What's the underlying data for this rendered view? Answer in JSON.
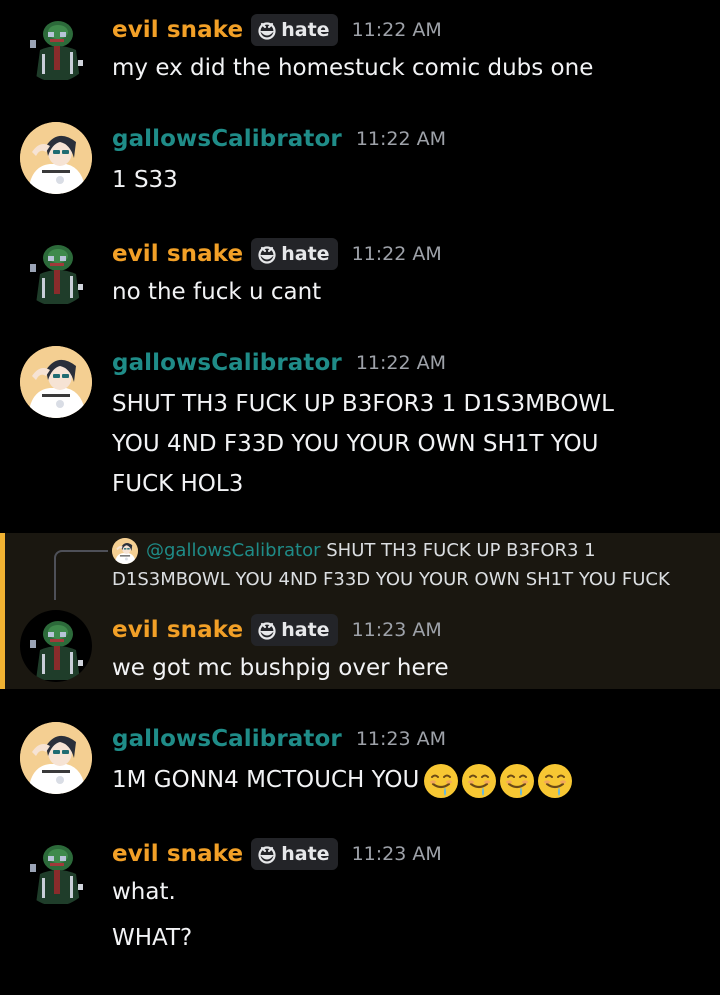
{
  "messages": [
    {
      "user": "evil snake",
      "tag": "hate",
      "time": "11:22 AM",
      "lines": [
        "my ex did the homestuck comic dubs one"
      ]
    },
    {
      "user": "gallowsCalibrator",
      "time": "11:22 AM",
      "lines": [
        "1 S33"
      ]
    },
    {
      "user": "evil snake",
      "tag": "hate",
      "time": "11:22 AM",
      "lines": [
        "no the fuck u cant"
      ]
    },
    {
      "user": "gallowsCalibrator",
      "time": "11:22 AM",
      "lines": [
        "SHUT TH3 FUCK UP B3FOR3 1 D1S3MBOWL",
        "YOU 4ND F33D YOU YOUR OWN SH1T YOU",
        "FUCK HOL3"
      ]
    },
    {
      "user": "evil snake",
      "tag": "hate",
      "time": "11:23 AM",
      "lines": [
        "we got mc bushpig over here"
      ],
      "reply": {
        "mention": "@gallowsCalibrator",
        "text_line1": "SHUT TH3 FUCK UP B3FOR3 1",
        "text_line2": "D1S3MBOWL YOU 4ND F33D YOU YOUR OWN SH1T YOU FUCK"
      }
    },
    {
      "user": "gallowsCalibrator",
      "time": "11:23 AM",
      "lines": [
        "1M GONN4 MCTOUCH YOU"
      ],
      "emoji_count": 4,
      "emoji_name": "drooling-face-emoji"
    },
    {
      "user": "evil snake",
      "tag": "hate",
      "time": "11:23 AM",
      "lines": [
        "what.",
        "WHAT?"
      ]
    }
  ],
  "colors": {
    "background": "#000000",
    "snake_name": "#f2a027",
    "gallows_name": "#1f8c88",
    "reply_highlight": "#1a1710",
    "reply_bar": "#f0b232",
    "timestamp": "#9ea2a9"
  },
  "icons": {
    "snake_avatar": "snake-avatar",
    "gallows_avatar": "gallows-avatar",
    "tag_icon": "hate-tag-icon"
  }
}
